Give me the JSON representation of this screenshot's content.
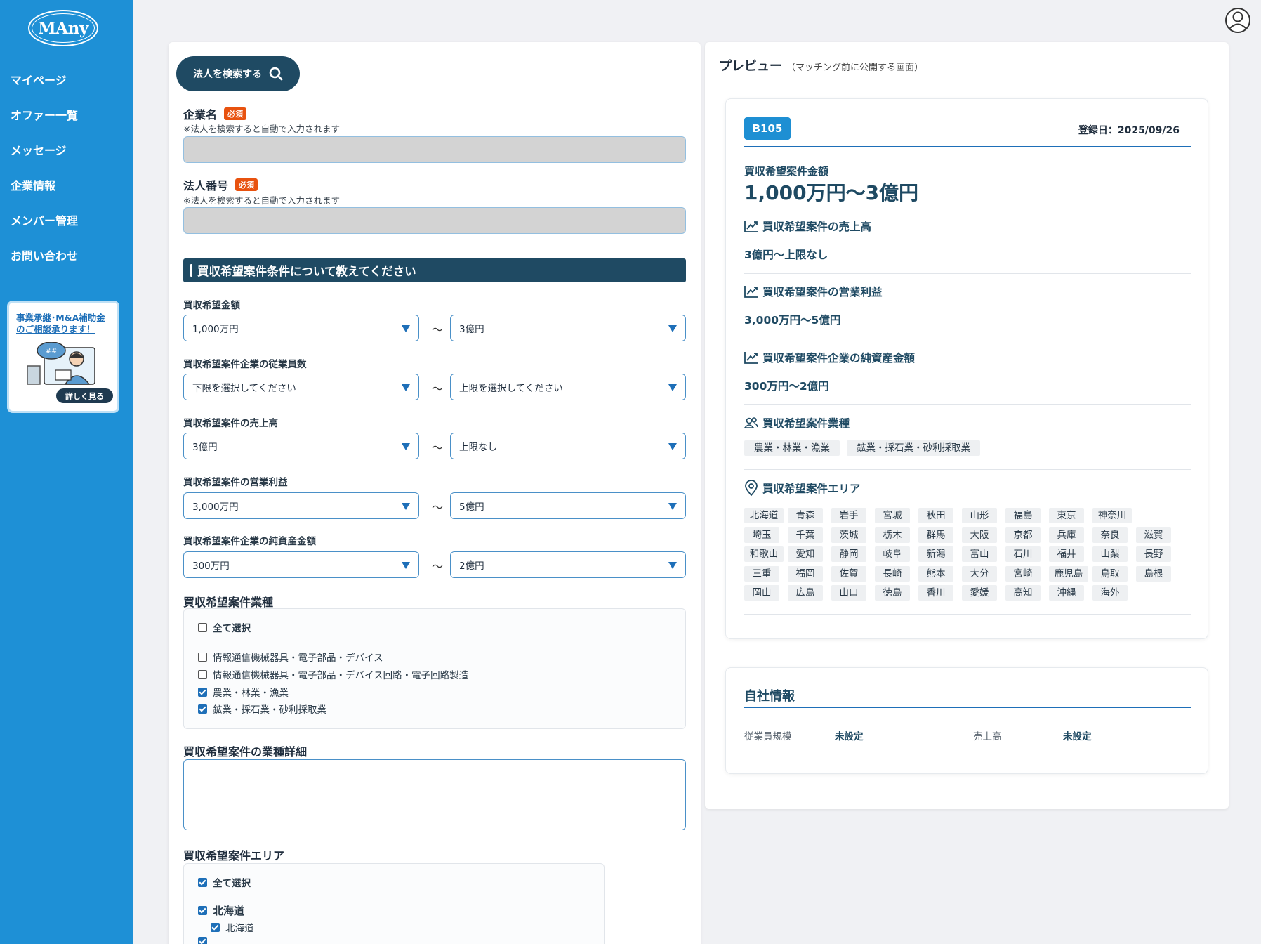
{
  "sidebar": {
    "logo": "MAny",
    "nav": [
      "マイページ",
      "オファー一覧",
      "メッセージ",
      "企業情報",
      "メンバー管理",
      "お問い合わせ"
    ],
    "promo": {
      "line1": "事業承継･M&A補助金",
      "line2": "のご相談承ります！",
      "button": "詳しく見る"
    }
  },
  "form": {
    "search_button": "法人を検索する",
    "company_name": {
      "label": "企業名",
      "required": "必須",
      "hint": "※法人を検索すると自動で入力されます"
    },
    "corp_number": {
      "label": "法人番号",
      "required": "必須",
      "hint": "※法人を検索すると自動で入力されます"
    },
    "section_title": "買収希望案件条件について教えてください",
    "ranges": [
      {
        "label": "買収希望金額",
        "min": "1,000万円",
        "max": "3億円"
      },
      {
        "label": "買収希望案件企業の従業員数",
        "min": "下限を選択してください",
        "max": "上限を選択してください"
      },
      {
        "label": "買収希望案件の売上高",
        "min": "3億円",
        "max": "上限なし"
      },
      {
        "label": "買収希望案件の営業利益",
        "min": "3,000万円",
        "max": "5億円"
      },
      {
        "label": "買収希望案件企業の純資産金額",
        "min": "300万円",
        "max": "2億円"
      }
    ],
    "tilde": "〜",
    "industry": {
      "label": "買収希望案件業種",
      "select_all": "全て選択",
      "options": [
        {
          "label": "情報通信機械器具・電子部品・デバイス",
          "checked": false
        },
        {
          "label": "情報通信機械器具・電子部品・デバイス回路・電子回路製造",
          "checked": false
        },
        {
          "label": "農業・林業・漁業",
          "checked": true
        },
        {
          "label": "鉱業・採石業・砂利採取業",
          "checked": true
        }
      ]
    },
    "industry_detail_label": "買収希望案件の業種詳細",
    "area": {
      "label": "買収希望案件エリア",
      "select_all": "全て選択",
      "region": "北海道",
      "sub": "北海道"
    }
  },
  "preview": {
    "title": "プレビュー",
    "subtitle": "（マッチング前に公開する画面）",
    "badge": "B105",
    "reg_date": "登録日：2025/09/26",
    "amount_caption": "買収希望案件金額",
    "amount_value": "1,000万円〜3億円",
    "sales_head": "買収希望案件の売上高",
    "sales_value": "3億円〜上限なし",
    "profit_head": "買収希望案件の営業利益",
    "profit_value": "3,000万円〜5億円",
    "netasset_head": "買収希望案件企業の純資産金額",
    "netasset_value": "300万円〜2億円",
    "industry_head": "買収希望案件業種",
    "industry_tags": [
      "農業・林業・漁業",
      "鉱業・採石業・砂利採取業"
    ],
    "area_head": "買収希望案件エリア",
    "prefectures": [
      [
        "北海道",
        "青森",
        "岩手",
        "宮城",
        "秋田",
        "山形",
        "福島",
        "東京",
        "神奈川"
      ],
      [
        "埼玉",
        "千葉",
        "茨城",
        "栃木",
        "群馬",
        "大阪",
        "京都",
        "兵庫",
        "奈良",
        "滋賀"
      ],
      [
        "和歌山",
        "愛知",
        "静岡",
        "岐阜",
        "新潟",
        "富山",
        "石川",
        "福井",
        "山梨",
        "長野"
      ],
      [
        "三重",
        "福岡",
        "佐賀",
        "長崎",
        "熊本",
        "大分",
        "宮崎",
        "鹿児島",
        "鳥取",
        "島根"
      ],
      [
        "岡山",
        "広島",
        "山口",
        "徳島",
        "香川",
        "愛媛",
        "高知",
        "沖縄",
        "海外"
      ]
    ],
    "own": {
      "title": "自社情報",
      "employees_key": "従業員規模",
      "employees_val": "未設定",
      "sales_key": "売上高",
      "sales_val": "未設定"
    }
  },
  "colors": {
    "sidebar": "#1e90d6",
    "navy": "#1f4a63",
    "accent": "#1e6fb8",
    "required": "#e8520f"
  }
}
